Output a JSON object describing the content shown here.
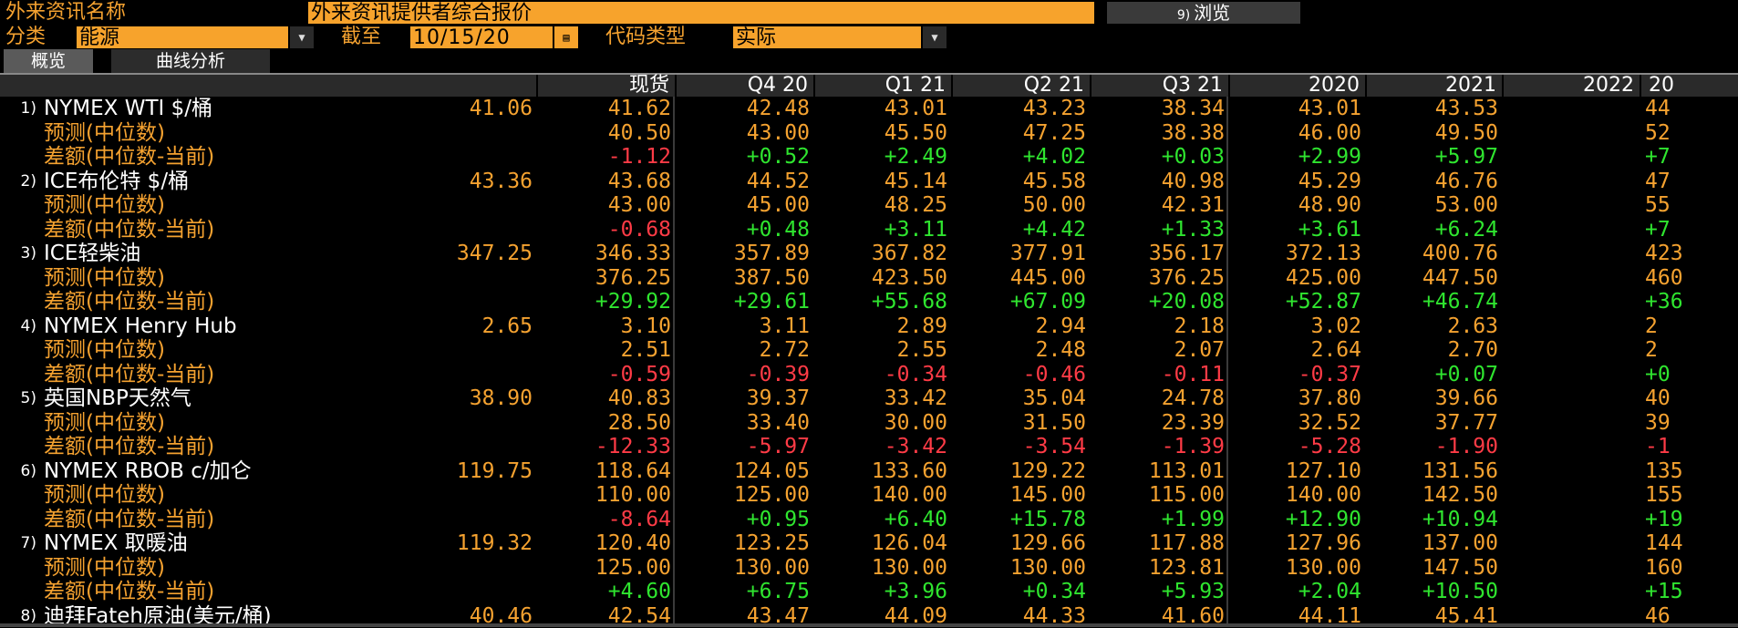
{
  "header": {
    "name_label": "外来资讯名称",
    "name_value": "外来资讯提供者综合报价",
    "browse_num": "9)",
    "browse_label": "浏览",
    "category_label": "分类",
    "category_value": "能源",
    "asof_label": "截至",
    "asof_value": "10/15/20",
    "code_label": "代码类型",
    "code_value": "实际"
  },
  "tabs": [
    "概览",
    "曲线分析"
  ],
  "columns": [
    "现货",
    "Q4 20",
    "Q1 21",
    "Q2 21",
    "Q3 21",
    "2020",
    "2021",
    "2022",
    "20"
  ],
  "icons": {
    "dropdown": "dropdown-arrow-icon",
    "calendar": "calendar-icon"
  },
  "colors": {
    "amber": "#f5a230",
    "negative": "#ff3b46",
    "positive": "#2fe52f"
  },
  "rows": [
    {
      "num": "1)",
      "name": "NYMEX WTI $/桶",
      "type": "main",
      "spot": "41.06",
      "vals": [
        "41.62",
        "42.48",
        "43.01",
        "43.23",
        "38.34",
        "43.01",
        "43.53",
        "44"
      ]
    },
    {
      "num": "",
      "name": "预测(中位数)",
      "type": "forecast",
      "spot": "",
      "vals": [
        "40.50",
        "43.00",
        "45.50",
        "47.25",
        "38.38",
        "46.00",
        "49.50",
        "52"
      ]
    },
    {
      "num": "",
      "name": "差额(中位数-当前)",
      "type": "diff",
      "spot": "",
      "vals": [
        "-1.12",
        "+0.52",
        "+2.49",
        "+4.02",
        "+0.03",
        "+2.99",
        "+5.97",
        "+7"
      ]
    },
    {
      "num": "2)",
      "name": "ICE布伦特 $/桶",
      "type": "main",
      "spot": "43.36",
      "vals": [
        "43.68",
        "44.52",
        "45.14",
        "45.58",
        "40.98",
        "45.29",
        "46.76",
        "47"
      ]
    },
    {
      "num": "",
      "name": "预测(中位数)",
      "type": "forecast",
      "spot": "",
      "vals": [
        "43.00",
        "45.00",
        "48.25",
        "50.00",
        "42.31",
        "48.90",
        "53.00",
        "55"
      ]
    },
    {
      "num": "",
      "name": "差额(中位数-当前)",
      "type": "diff",
      "spot": "",
      "vals": [
        "-0.68",
        "+0.48",
        "+3.11",
        "+4.42",
        "+1.33",
        "+3.61",
        "+6.24",
        "+7"
      ]
    },
    {
      "num": "3)",
      "name": "ICE轻柴油",
      "type": "main",
      "spot": "347.25",
      "vals": [
        "346.33",
        "357.89",
        "367.82",
        "377.91",
        "356.17",
        "372.13",
        "400.76",
        "423"
      ]
    },
    {
      "num": "",
      "name": "预测(中位数)",
      "type": "forecast",
      "spot": "",
      "vals": [
        "376.25",
        "387.50",
        "423.50",
        "445.00",
        "376.25",
        "425.00",
        "447.50",
        "460"
      ]
    },
    {
      "num": "",
      "name": "差额(中位数-当前)",
      "type": "diff",
      "spot": "",
      "vals": [
        "+29.92",
        "+29.61",
        "+55.68",
        "+67.09",
        "+20.08",
        "+52.87",
        "+46.74",
        "+36"
      ]
    },
    {
      "num": "4)",
      "name": "NYMEX Henry Hub",
      "type": "main",
      "spot": "2.65",
      "vals": [
        "3.10",
        "3.11",
        "2.89",
        "2.94",
        "2.18",
        "3.02",
        "2.63",
        "2"
      ]
    },
    {
      "num": "",
      "name": "预测(中位数)",
      "type": "forecast",
      "spot": "",
      "vals": [
        "2.51",
        "2.72",
        "2.55",
        "2.48",
        "2.07",
        "2.64",
        "2.70",
        "2"
      ]
    },
    {
      "num": "",
      "name": "差额(中位数-当前)",
      "type": "diff",
      "spot": "",
      "vals": [
        "-0.59",
        "-0.39",
        "-0.34",
        "-0.46",
        "-0.11",
        "-0.37",
        "+0.07",
        "+0"
      ]
    },
    {
      "num": "5)",
      "name": "英国NBP天然气",
      "type": "main",
      "spot": "38.90",
      "vals": [
        "40.83",
        "39.37",
        "33.42",
        "35.04",
        "24.78",
        "37.80",
        "39.66",
        "40"
      ]
    },
    {
      "num": "",
      "name": "预测(中位数)",
      "type": "forecast",
      "spot": "",
      "vals": [
        "28.50",
        "33.40",
        "30.00",
        "31.50",
        "23.39",
        "32.52",
        "37.77",
        "39"
      ]
    },
    {
      "num": "",
      "name": "差额(中位数-当前)",
      "type": "diff",
      "spot": "",
      "vals": [
        "-12.33",
        "-5.97",
        "-3.42",
        "-3.54",
        "-1.39",
        "-5.28",
        "-1.90",
        "-1"
      ]
    },
    {
      "num": "6)",
      "name": "NYMEX RBOB c/加仑",
      "type": "main",
      "spot": "119.75",
      "vals": [
        "118.64",
        "124.05",
        "133.60",
        "129.22",
        "113.01",
        "127.10",
        "131.56",
        "135"
      ]
    },
    {
      "num": "",
      "name": "预测(中位数)",
      "type": "forecast",
      "spot": "",
      "vals": [
        "110.00",
        "125.00",
        "140.00",
        "145.00",
        "115.00",
        "140.00",
        "142.50",
        "155"
      ]
    },
    {
      "num": "",
      "name": "差额(中位数-当前)",
      "type": "diff",
      "spot": "",
      "vals": [
        "-8.64",
        "+0.95",
        "+6.40",
        "+15.78",
        "+1.99",
        "+12.90",
        "+10.94",
        "+19"
      ]
    },
    {
      "num": "7)",
      "name": "NYMEX 取暖油",
      "type": "main",
      "spot": "119.32",
      "vals": [
        "120.40",
        "123.25",
        "126.04",
        "129.66",
        "117.88",
        "127.96",
        "137.00",
        "144"
      ]
    },
    {
      "num": "",
      "name": "预测(中位数)",
      "type": "forecast",
      "spot": "",
      "vals": [
        "125.00",
        "130.00",
        "130.00",
        "130.00",
        "123.81",
        "130.00",
        "147.50",
        "160"
      ]
    },
    {
      "num": "",
      "name": "差额(中位数-当前)",
      "type": "diff",
      "spot": "",
      "vals": [
        "+4.60",
        "+6.75",
        "+3.96",
        "+0.34",
        "+5.93",
        "+2.04",
        "+10.50",
        "+15"
      ]
    },
    {
      "num": "8)",
      "name": "迪拜Fateh原油(美元/桶)",
      "type": "main",
      "spot": "40.46",
      "vals": [
        "42.54",
        "43.47",
        "44.09",
        "44.33",
        "41.60",
        "44.11",
        "45.41",
        "46"
      ]
    }
  ]
}
